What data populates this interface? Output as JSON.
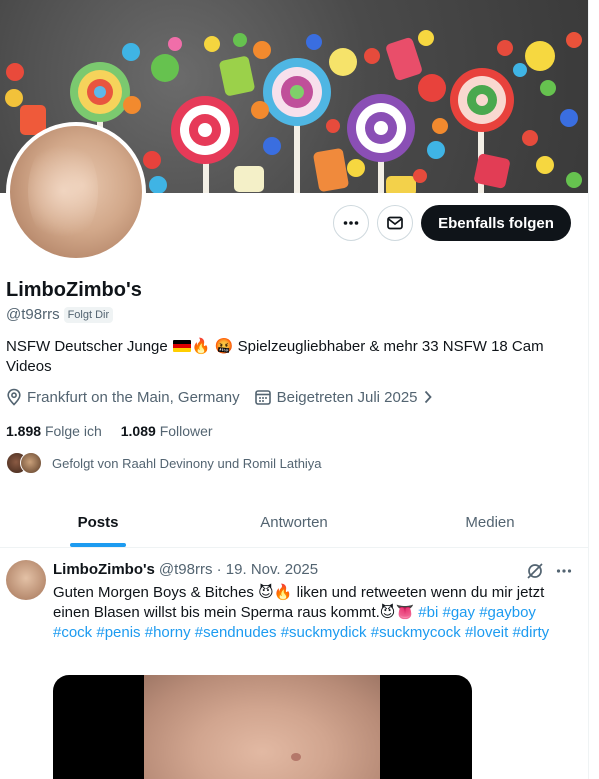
{
  "profile": {
    "name": "LimboZimbo's",
    "handle": "@t98rrs",
    "follows_you": "Folgt Dir",
    "bio_part1": "NSFW Deutscher Junge",
    "bio_part2": "Spielzeugliebhaber & mehr 33 NSFW 18 Cam Videos",
    "location": "Frankfurt on the Main, Germany",
    "joined": "Beigetreten Juli 2025",
    "following_count": "1.898",
    "following_label": "Folge ich",
    "followers_count": "1.089",
    "followers_label": "Follower",
    "followed_by": "Gefolgt von Raahl Devinony und Romil Lathiya"
  },
  "actions": {
    "more_icon": "more-horizontal-icon",
    "message_icon": "envelope-icon",
    "follow_label": "Ebenfalls folgen"
  },
  "tabs": [
    {
      "label": "Posts",
      "active": true
    },
    {
      "label": "Antworten",
      "active": false
    },
    {
      "label": "Medien",
      "active": false
    }
  ],
  "post": {
    "author": "LimboZimbo's",
    "meta": "@t98rrs · 19. Nov. 2025",
    "text_part1": "Guten Morgen Boys & Bitches",
    "text_part2": "liken und retweeten wenn du mir jetzt einen Blasen willst bis mein Sperma raus kommt.",
    "hashtags": [
      "#bi",
      "#gay",
      "#gayboy",
      "#cock",
      "#penis",
      "#horny",
      "#sendnudes",
      "#suckmydick",
      "#suckmycock",
      "#loveit",
      "#dirty"
    ]
  },
  "colors": {
    "accent": "#1d9bf0",
    "text": "#0f1419",
    "muted": "#536471",
    "follow_button": "#0f1419"
  }
}
